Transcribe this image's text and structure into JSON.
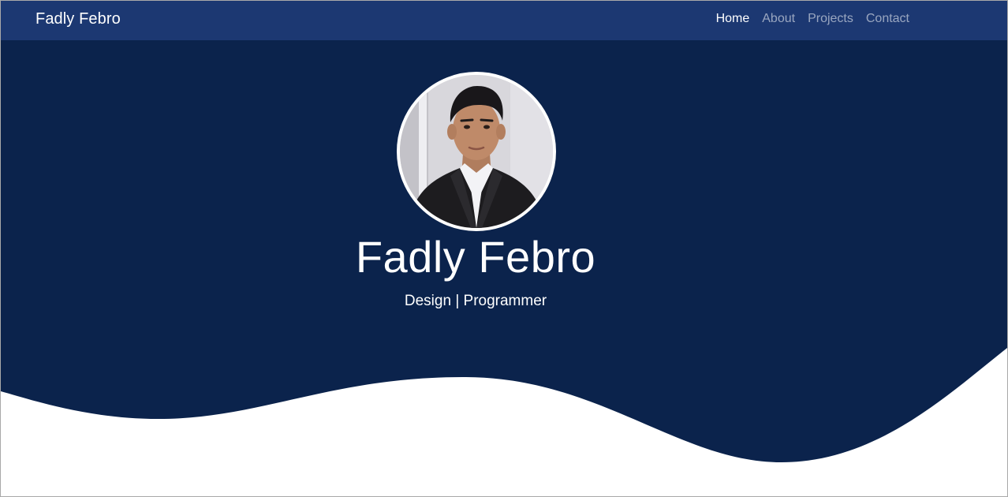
{
  "navbar": {
    "brand": "Fadly Febro",
    "links": [
      {
        "label": "Home",
        "active": true
      },
      {
        "label": "About",
        "active": false
      },
      {
        "label": "Projects",
        "active": false
      },
      {
        "label": "Contact",
        "active": false
      }
    ]
  },
  "hero": {
    "name": "Fadly Febro",
    "subtitle": "Design | Programmer"
  },
  "colors": {
    "navbar_bg": "#1c3872",
    "hero_bg": "#0b234c",
    "text": "#ffffff",
    "link_inactive": "rgba(255,255,255,0.55)"
  }
}
